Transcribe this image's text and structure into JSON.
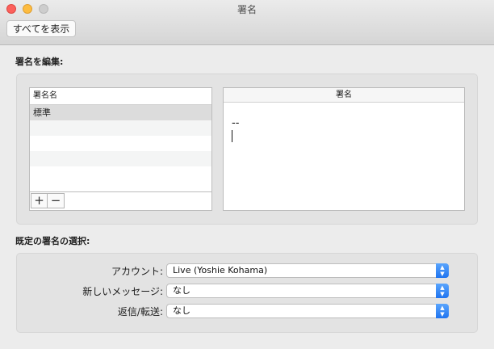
{
  "window": {
    "title": "署名"
  },
  "toolbar": {
    "show_all_label": "すべてを表示"
  },
  "edit_section": {
    "label": "署名を編集:",
    "list_header": "署名名",
    "signatures": [
      "標準"
    ],
    "add_symbol": "+",
    "remove_symbol": "−",
    "editor_header": "署名",
    "editor_text": "--"
  },
  "default_section": {
    "label": "既定の署名の選択:",
    "account_label": "アカウント:",
    "account_value": "Live (Yoshie Kohama)",
    "new_message_label": "新しいメッセージ:",
    "new_message_value": "なし",
    "reply_forward_label": "返信/転送:",
    "reply_forward_value": "なし"
  },
  "colors": {
    "close": "#fc605c",
    "minimize": "#fdbc40",
    "popup_accent": "#1f74f0"
  }
}
